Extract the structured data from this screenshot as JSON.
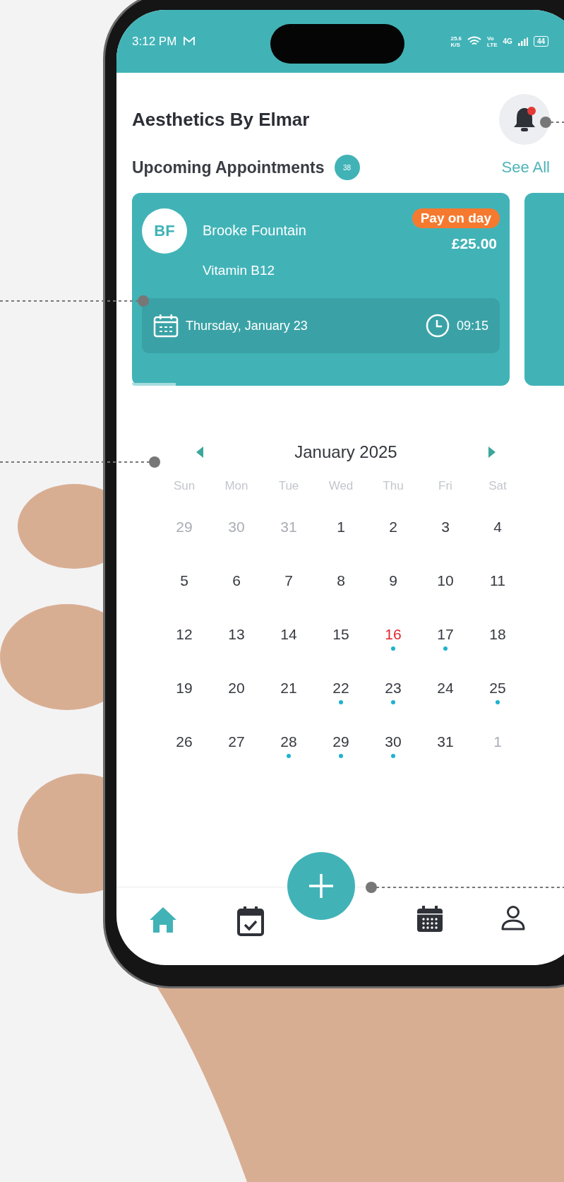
{
  "status_bar": {
    "time": "3:12 PM",
    "net_speed": "25.6",
    "net_speed_unit": "K/S",
    "volte_top": "Vo",
    "volte_bottom": "LTE",
    "network": "4G",
    "battery": "44"
  },
  "header": {
    "title": "Aesthetics By Elmar",
    "notifications_unread": true
  },
  "upcoming": {
    "title": "Upcoming Appointments",
    "count": "38",
    "see_all": "See All"
  },
  "appointments": [
    {
      "initials": "BF",
      "name": "Brooke Fountain",
      "service": "Vitamin B12",
      "payment_badge": "Pay on day",
      "price": "£25.00",
      "date": "Thursday, January 23",
      "time": "09:15"
    }
  ],
  "calendar": {
    "month": "January 2025",
    "weekdays": [
      "Sun",
      "Mon",
      "Tue",
      "Wed",
      "Thu",
      "Fri",
      "Sat"
    ],
    "weeks": [
      [
        {
          "day": "29",
          "outside": true,
          "today": false,
          "has_event": false
        },
        {
          "day": "30",
          "outside": true,
          "today": false,
          "has_event": false
        },
        {
          "day": "31",
          "outside": true,
          "today": false,
          "has_event": false
        },
        {
          "day": "1",
          "outside": false,
          "today": false,
          "has_event": false
        },
        {
          "day": "2",
          "outside": false,
          "today": false,
          "has_event": false
        },
        {
          "day": "3",
          "outside": false,
          "today": false,
          "has_event": false
        },
        {
          "day": "4",
          "outside": false,
          "today": false,
          "has_event": false
        }
      ],
      [
        {
          "day": "5",
          "outside": false,
          "today": false,
          "has_event": false
        },
        {
          "day": "6",
          "outside": false,
          "today": false,
          "has_event": false
        },
        {
          "day": "7",
          "outside": false,
          "today": false,
          "has_event": false
        },
        {
          "day": "8",
          "outside": false,
          "today": false,
          "has_event": false
        },
        {
          "day": "9",
          "outside": false,
          "today": false,
          "has_event": false
        },
        {
          "day": "10",
          "outside": false,
          "today": false,
          "has_event": false
        },
        {
          "day": "11",
          "outside": false,
          "today": false,
          "has_event": false
        }
      ],
      [
        {
          "day": "12",
          "outside": false,
          "today": false,
          "has_event": false
        },
        {
          "day": "13",
          "outside": false,
          "today": false,
          "has_event": false
        },
        {
          "day": "14",
          "outside": false,
          "today": false,
          "has_event": false
        },
        {
          "day": "15",
          "outside": false,
          "today": false,
          "has_event": false
        },
        {
          "day": "16",
          "outside": false,
          "today": true,
          "has_event": true
        },
        {
          "day": "17",
          "outside": false,
          "today": false,
          "has_event": true
        },
        {
          "day": "18",
          "outside": false,
          "today": false,
          "has_event": false
        }
      ],
      [
        {
          "day": "19",
          "outside": false,
          "today": false,
          "has_event": false
        },
        {
          "day": "20",
          "outside": false,
          "today": false,
          "has_event": false
        },
        {
          "day": "21",
          "outside": false,
          "today": false,
          "has_event": false
        },
        {
          "day": "22",
          "outside": false,
          "today": false,
          "has_event": true
        },
        {
          "day": "23",
          "outside": false,
          "today": false,
          "has_event": true
        },
        {
          "day": "24",
          "outside": false,
          "today": false,
          "has_event": false
        },
        {
          "day": "25",
          "outside": false,
          "today": false,
          "has_event": true
        }
      ],
      [
        {
          "day": "26",
          "outside": false,
          "today": false,
          "has_event": false
        },
        {
          "day": "27",
          "outside": false,
          "today": false,
          "has_event": false
        },
        {
          "day": "28",
          "outside": false,
          "today": false,
          "has_event": true
        },
        {
          "day": "29",
          "outside": false,
          "today": false,
          "has_event": true
        },
        {
          "day": "30",
          "outside": false,
          "today": false,
          "has_event": true
        },
        {
          "day": "31",
          "outside": false,
          "today": false,
          "has_event": false
        },
        {
          "day": "1",
          "outside": true,
          "today": false,
          "has_event": false
        }
      ]
    ]
  },
  "bottom_nav": [
    {
      "kind": "home",
      "selected": true
    },
    {
      "kind": "appointments",
      "selected": false
    },
    {
      "kind": "fab",
      "selected": false
    },
    {
      "kind": "calendar",
      "selected": false
    },
    {
      "kind": "profile",
      "selected": false
    }
  ]
}
